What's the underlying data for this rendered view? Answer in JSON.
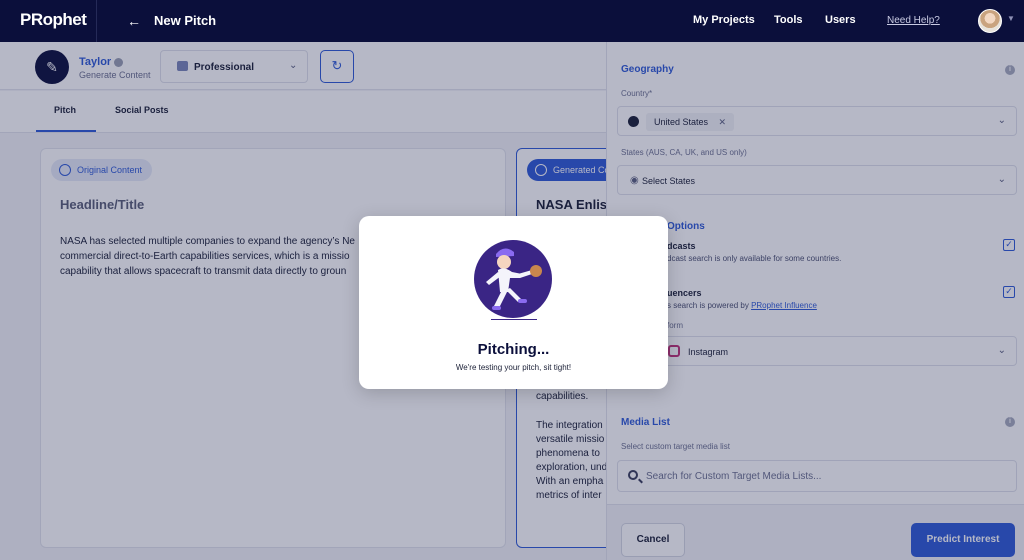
{
  "topnav": {
    "logo": "PRophet",
    "title": "New Pitch",
    "links": [
      "My Projects",
      "Tools",
      "Users"
    ],
    "help": "Need Help?"
  },
  "header": {
    "user_name": "Taylor",
    "user_sub": "Generate Content",
    "tone": "Professional"
  },
  "tabs": [
    "Pitch",
    "Social Posts"
  ],
  "original": {
    "chip": "Original Content",
    "heading": "Headline/Title",
    "body": "NASA has selected multiple companies to expand the agency’s Ne\ncommercial direct-to-Earth capabilities services, which is a missio\ncapability that allows spacecraft to transmit data directly to groun"
  },
  "generated": {
    "chip": "Generated Co",
    "heading": "NASA Enlis",
    "body_top": "capabilities.",
    "body": "The integration\nversatile missio\nphenomena to\nexploration, und\nWith an empha\nmetrics of inter"
  },
  "panel": {
    "geography_title": "Geography",
    "country_label": "Country*",
    "country_value": "United States",
    "states_label": "States (AUS, CA, UK, and US only)",
    "states_placeholder": "Select States",
    "options_title": "Options",
    "podcasts_title": "dcasts",
    "podcasts_desc": "dcast search is only available for some countries.",
    "influencers_title": "uencers",
    "influencers_desc": "s search is powered by",
    "influencers_link": "PRophet Influence",
    "platform_label": "form",
    "platform_value": "Instagram",
    "media_title": "Media List",
    "media_label": "Select custom target media list",
    "media_placeholder": "Search for Custom Target Media Lists...",
    "cancel": "Cancel",
    "predict": "Predict Interest"
  },
  "modal": {
    "title": "Pitching...",
    "subtitle": "We're testing your pitch, sit tight!"
  },
  "colors": {
    "nav_bg": "#0b0f3b",
    "accent": "#2f5bd6",
    "illustration_bg": "#3a2585"
  }
}
